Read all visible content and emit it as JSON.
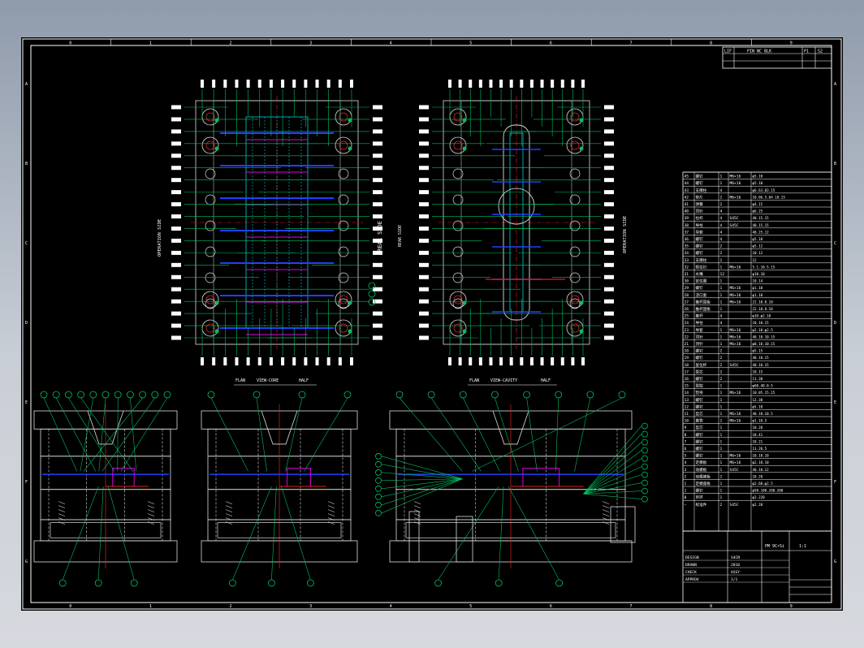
{
  "title_block": {
    "top_label_1": "LIF",
    "top_label_2": "PIN NC BLK",
    "top_label_3": "P1",
    "top_label_4": "S2",
    "material_label": "PM 9CrSi",
    "scale_label": "1:1",
    "footer_rows": [
      "DESIGN",
      "DRAWN",
      "CHECK",
      "APPROV"
    ],
    "footer_values": [
      "S4CN",
      "2010",
      "ASSY",
      "1/1"
    ]
  },
  "views": {
    "operation_side_left": "OPERATION SIDE",
    "operation_side_right": "OPERATION SIDE",
    "rear_side": "REAR SIDE",
    "rear_side_small": "REAR SIDE",
    "section_label_left": "FLAN",
    "section_label_left_mid": "VIEW-CORE",
    "section_label_left_end": "HALF",
    "section_label_right": "FLAN",
    "section_label_right_mid": "VIEW-CAVITY",
    "section_label_right_end": "HALF"
  },
  "border": {
    "top_ticks": [
      "0",
      "1",
      "2",
      "3",
      "4",
      "5",
      "6",
      "7",
      "8",
      "9"
    ],
    "bottom_ticks": [
      "0",
      "1",
      "2",
      "3",
      "4",
      "5",
      "6",
      "7",
      "8",
      "9"
    ],
    "left_ticks": [
      "A",
      "B",
      "C",
      "D",
      "E",
      "F",
      "G"
    ],
    "right_ticks": [
      "A",
      "B",
      "C",
      "D",
      "E",
      "F",
      "G"
    ]
  },
  "bom": {
    "rows": [
      [
        "45",
        "螺钉",
        "1",
        "M6×16",
        "φ5.10"
      ],
      [
        "44",
        "螺钉",
        "1",
        "M6×16",
        "φ5.10"
      ],
      [
        "43",
        "支撑柱",
        "4",
        "",
        "φ6.63.03.15"
      ],
      [
        "42",
        "垫片",
        "2",
        "M6×16",
        "10.06.5.04.18.15"
      ],
      [
        "41",
        "弹簧",
        "2",
        "",
        "φ4.15"
      ],
      [
        "40",
        "顶针",
        "4",
        "",
        "φ6.25"
      ],
      [
        "39",
        "拉杆",
        "4",
        "S45C",
        "40.15.15"
      ],
      [
        "38",
        "导柱",
        "4",
        "S45C",
        "40.15.15"
      ],
      [
        "37",
        "导套",
        "4",
        "",
        "40.25.12"
      ],
      [
        "36",
        "螺钉",
        "4",
        "",
        "φ5.10"
      ],
      [
        "35",
        "螺钉",
        "2",
        "",
        "φ5.12"
      ],
      [
        "34",
        "螺钉",
        "2",
        "",
        "10.12"
      ],
      [
        "33",
        "支撑柱",
        "1",
        "",
        "12"
      ],
      [
        "32",
        "限位钉",
        "1",
        "M6×16",
        "5.1.10.5.15"
      ],
      [
        "31",
        "水嘴",
        "12",
        "",
        "φ10.10"
      ],
      [
        "30",
        "定位圈",
        "1",
        "",
        "10.14"
      ],
      [
        "29",
        "螺钉",
        "1",
        "M6×16",
        "φ1.10"
      ],
      [
        "28",
        "浇口套",
        "1",
        "M6×16",
        "φ1.10"
      ],
      [
        "27",
        "推杆固板",
        "1",
        "M6×16",
        "22.10.8.10"
      ],
      [
        "26",
        "推杆固板",
        "1",
        "",
        "22.10.8.10"
      ],
      [
        "25",
        "推杆",
        "4",
        "",
        "φ10.φ2.10"
      ],
      [
        "24",
        "导柱",
        "4",
        "",
        "10.10.15"
      ],
      [
        "23",
        "导套",
        "1",
        "M6×16",
        "φ2.10.φ2.5"
      ],
      [
        "22",
        "顶针",
        "1",
        "M6×16",
        "40.10.10.15"
      ],
      [
        "21",
        "顶针",
        "1",
        "M6×16",
        "φ0.10.10.15"
      ],
      [
        "20",
        "螺钉",
        "2",
        "",
        "φ5.15"
      ],
      [
        "19",
        "螺钉",
        "2",
        "",
        "40.10.15"
      ],
      [
        "18",
        "复位杆",
        "2",
        "S45C",
        "40.10.15"
      ],
      [
        "17",
        "型芯",
        "2",
        "",
        "10.15"
      ],
      [
        "16",
        "螺钉",
        "2",
        "",
        "11.30"
      ],
      [
        "15",
        "型腔",
        "1",
        "",
        "φ60.40.0.5"
      ],
      [
        "14",
        "垫块",
        "1",
        "M6×16",
        "10.05.15.15"
      ],
      [
        "13",
        "螺钉",
        "1",
        "",
        "12.30"
      ],
      [
        "12",
        "螺钉",
        "1",
        "",
        "φ5.10"
      ],
      [
        "11",
        "型芯",
        "1",
        "M6×16",
        "40.10.10.5"
      ],
      [
        "10",
        "推管",
        "1",
        "M6×16",
        "φ1.10.5"
      ],
      [
        "9",
        "型芯",
        "1",
        "",
        "10.20"
      ],
      [
        "8",
        "螺钉",
        "1",
        "",
        "10.41"
      ],
      [
        "7",
        "螺钉",
        "1",
        "",
        "10.21"
      ],
      [
        "6",
        "螺钉",
        "1",
        "",
        "13.20.5"
      ],
      [
        "5",
        "螺钉",
        "1",
        "M6×16",
        "10.10.10"
      ],
      [
        "4",
        "定模板",
        "1",
        "M6×16",
        "φ2.10.10"
      ],
      [
        "3",
        "动模板",
        "1",
        "S45C",
        "40.10.12"
      ],
      [
        "2",
        "动模座板",
        "1",
        "",
        "10.20"
      ],
      [
        "1",
        "定模座板",
        "1",
        "",
        "φ2.60.φ2.5"
      ]
    ],
    "extra_rows": [
      [
        "1",
        "螺钉",
        "1",
        "",
        "φ50.100.200.200"
      ],
      [
        "0",
        "吊环",
        "1",
        "",
        "φ2.220"
      ],
      [
        "—",
        "标准件",
        "2",
        "S45C",
        "φ2.20"
      ]
    ]
  },
  "colors": {
    "background": "#000000",
    "frame": "#ffffff",
    "leader": "#00c060",
    "center": "#e02020",
    "accent_blue": "#2040ff",
    "accent_cyan": "#00d0d0",
    "accent_yellow": "#e0e000",
    "accent_magenta": "#e000e0"
  }
}
